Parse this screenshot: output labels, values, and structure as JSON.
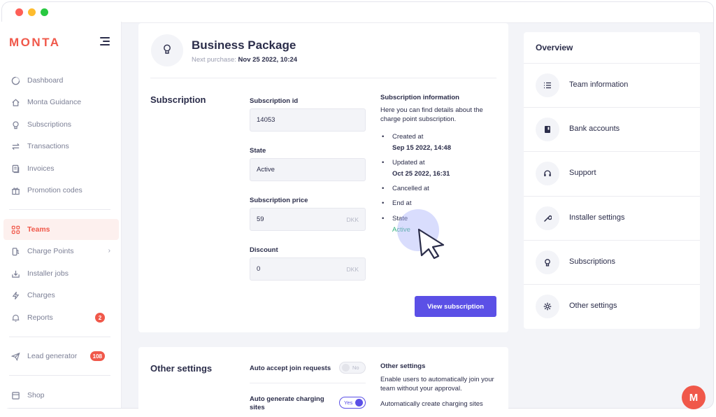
{
  "brand": {
    "logo_text": "MONTA",
    "accent": "#f0584a",
    "primary": "#5b50e6",
    "success": "#2fae7a"
  },
  "sidebar": {
    "items": [
      {
        "label": "Dashboard",
        "icon": "dashboard-icon"
      },
      {
        "label": "Monta Guidance",
        "icon": "home-icon"
      },
      {
        "label": "Subscriptions",
        "icon": "lightbulb-icon"
      },
      {
        "label": "Transactions",
        "icon": "swap-arrows-icon"
      },
      {
        "label": "Invoices",
        "icon": "invoice-icon"
      },
      {
        "label": "Promotion codes",
        "icon": "gift-icon"
      },
      {
        "label": "Teams",
        "icon": "grid-icon",
        "active": true
      },
      {
        "label": "Charge Points",
        "icon": "charge-point-icon",
        "chevron": "›"
      },
      {
        "label": "Installer jobs",
        "icon": "download-box-icon"
      },
      {
        "label": "Charges",
        "icon": "lightning-icon"
      },
      {
        "label": "Reports",
        "icon": "bell-icon",
        "badge": "2"
      },
      {
        "label": "Lead generator",
        "icon": "send-icon",
        "badge": "108"
      },
      {
        "label": "Shop",
        "icon": "shop-icon"
      }
    ]
  },
  "package": {
    "title": "Business Package",
    "next_purchase_label": "Next purchase:",
    "next_purchase_value": "Nov 25 2022, 10:24",
    "icon": "lightbulb-icon"
  },
  "subscription": {
    "section_title": "Subscription",
    "fields": {
      "id": {
        "label": "Subscription id",
        "value": "14053"
      },
      "state": {
        "label": "State",
        "value": "Active"
      },
      "price": {
        "label": "Subscription price",
        "value": "59",
        "unit": "DKK"
      },
      "discount": {
        "label": "Discount",
        "value": "0",
        "unit": "DKK"
      }
    },
    "info": {
      "title": "Subscription information",
      "description": "Here you can find details about the charge point subscription.",
      "items": [
        {
          "label": "Created at",
          "value": "Sep 15 2022, 14:48"
        },
        {
          "label": "Updated at",
          "value": "Oct 25 2022, 16:31"
        },
        {
          "label": "Cancelled at",
          "value": ""
        },
        {
          "label": "End at",
          "value": ""
        },
        {
          "label": "State",
          "value": "Active"
        }
      ]
    },
    "view_button": "View subscription"
  },
  "other_settings": {
    "section_title": "Other settings",
    "toggles": [
      {
        "label": "Auto accept join requests",
        "state_label": "No",
        "on": false
      },
      {
        "label": "Auto generate charging sites",
        "state_label": "Yes",
        "on": true
      }
    ],
    "info_title": "Other settings",
    "info_desc_1": "Enable users to automatically join your team without your approval.",
    "info_desc_2": "Automatically create charging sites"
  },
  "overview": {
    "title": "Overview",
    "items": [
      {
        "label": "Team information",
        "icon": "list-icon"
      },
      {
        "label": "Bank accounts",
        "icon": "bank-book-icon"
      },
      {
        "label": "Support",
        "icon": "headset-icon"
      },
      {
        "label": "Installer settings",
        "icon": "wrench-icon"
      },
      {
        "label": "Subscriptions",
        "icon": "lightbulb-icon"
      },
      {
        "label": "Other settings",
        "icon": "gear-icon"
      }
    ]
  },
  "fab": {
    "letter": "M"
  }
}
